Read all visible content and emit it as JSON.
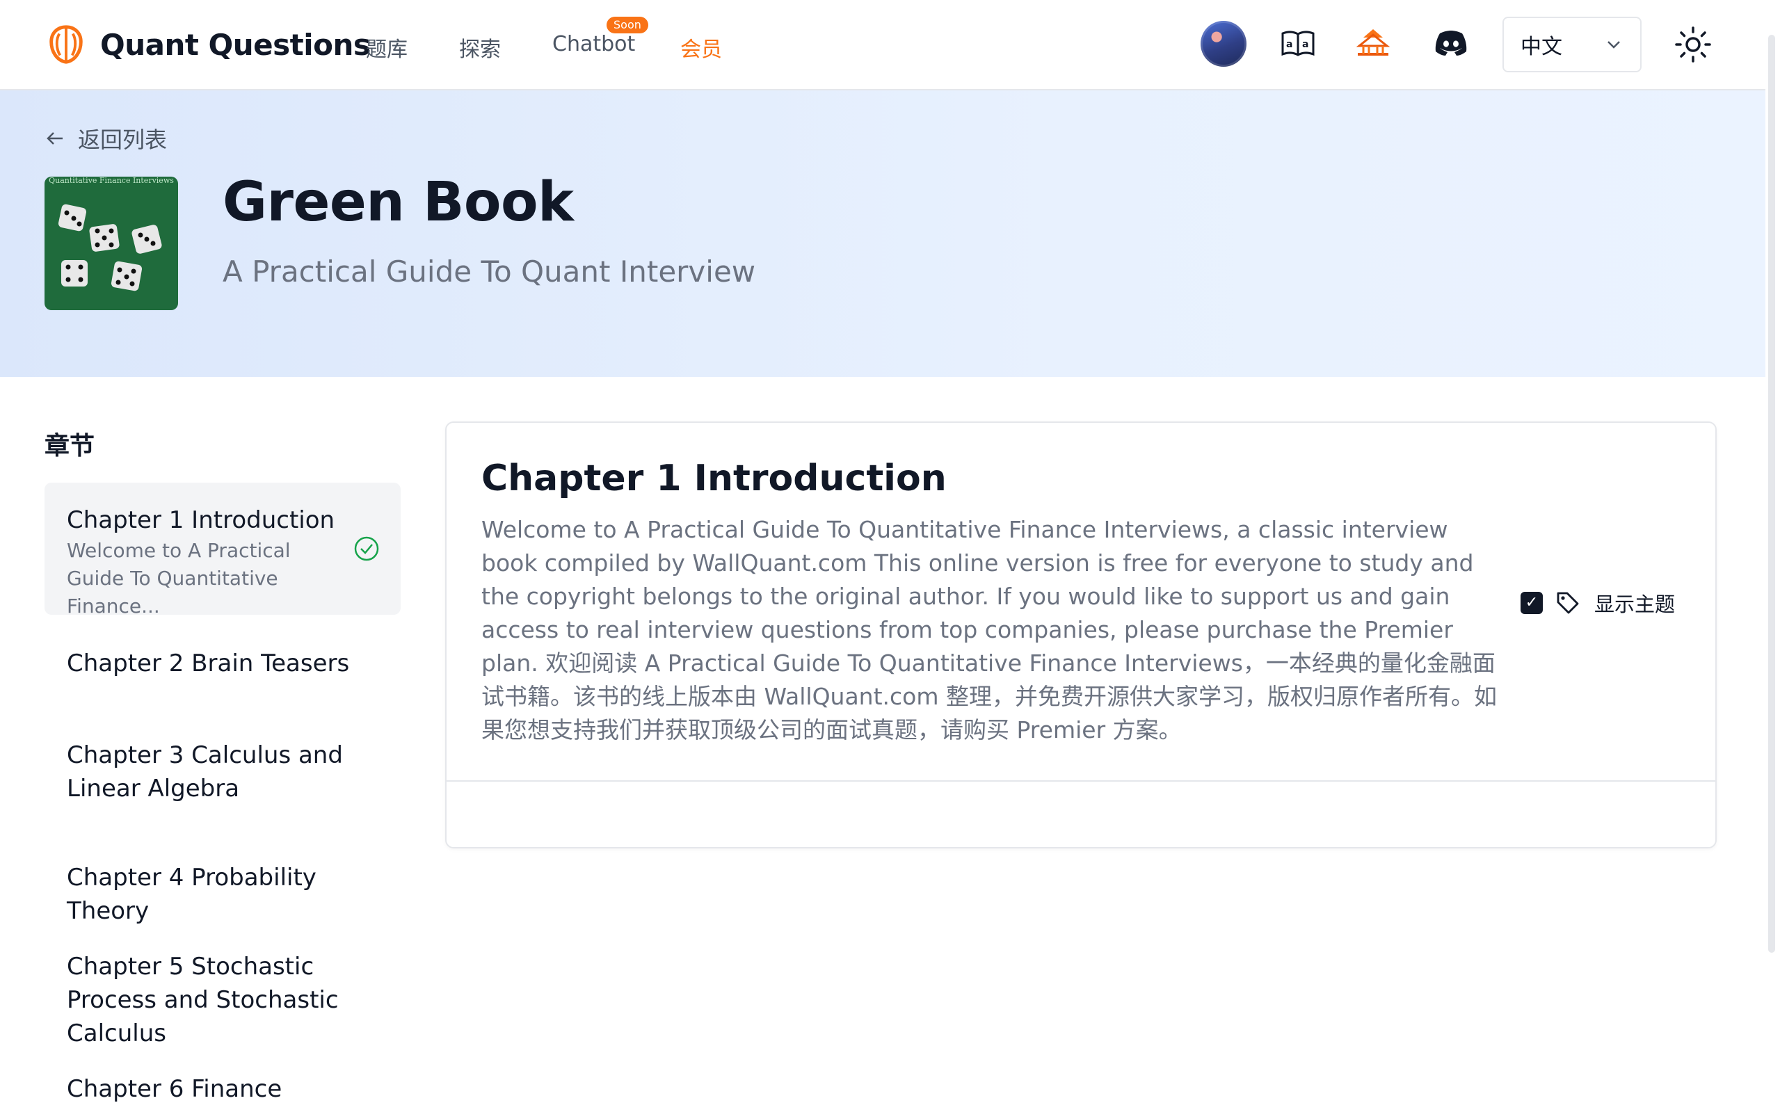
{
  "app": {
    "brand_name": "Quant Questions",
    "accent_color": "#f97316"
  },
  "nav": {
    "links": [
      {
        "label": "题库",
        "icon": null
      },
      {
        "label": "探索",
        "icon": null
      },
      {
        "label": "Chatbot",
        "badge": "Soon"
      },
      {
        "label": "会员"
      }
    ],
    "icons": [
      "avatar",
      "book-icon",
      "pagoda-icon",
      "discord-icon"
    ],
    "language": {
      "selected": "中文"
    },
    "theme_icon": "sun-icon"
  },
  "hero": {
    "back_label": "返回列表",
    "cover_text": "Quantitative Finance Interviews",
    "title": "Green Book",
    "subtitle": "A Practical Guide To Quant Interview"
  },
  "sidebar": {
    "title": "章节",
    "chapters": [
      {
        "label": "Chapter 1 Introduction",
        "desc": "Welcome to A Practical Guide To Quantitative Finance...",
        "completed": true
      },
      {
        "label": "Chapter 2 Brain Teasers"
      },
      {
        "label": "Chapter 3 Calculus and Linear Algebra"
      },
      {
        "label": "Chapter 4 Probability Theory"
      },
      {
        "label": "Chapter 5 Stochastic Process and Stochastic Calculus"
      },
      {
        "label": "Chapter 6 Finance"
      }
    ]
  },
  "content": {
    "title": "Chapter 1 Introduction",
    "body": "Welcome to A Practical Guide To Quantitative Finance Interviews, a classic interview book compiled by WallQuant.com This online version is free for everyone to study and the copyright belongs to the original author. If you would like to support us and gain access to real interview questions from top companies, please purchase the Premier plan. 欢迎阅读 A Practical Guide To Quantitative Finance Interviews，一本经典的量化金融面试书籍。该书的线上版本由 WallQuant.com 整理，并免费开源供大家学习，版权归原作者所有。如果您想支持我们并获取顶级公司的面试真题，请购买 Premier 方案。",
    "show_topics_label": "显示主题",
    "show_topics_checked": true,
    "checkbox_mark": "✓"
  }
}
